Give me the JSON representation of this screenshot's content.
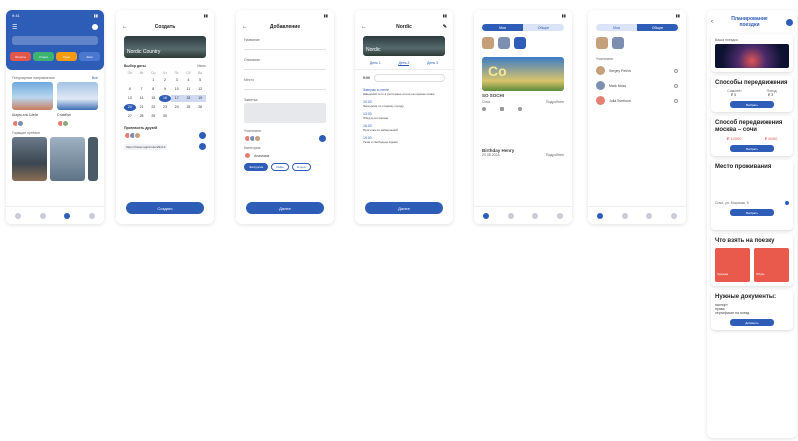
{
  "screen1": {
    "status_time": "9:41",
    "chips": [
      "Билеты",
      "Отели",
      "Туры",
      "Авто"
    ],
    "chip_colors": [
      "#e2574c",
      "#3cb371",
      "#f39c12",
      "#2e5db8"
    ],
    "section1_title": "Популярные направления",
    "section1_more": "Все",
    "item1_title": "Шарм-эль-Шейх",
    "item2_title": "Стамбул",
    "section2_title": "Горящие путёвки"
  },
  "screen2": {
    "title": "Создать",
    "hero_text": "Nordic Country",
    "dates_label": "Выбор даты",
    "month": "Июнь",
    "weekdays": [
      "Пн",
      "Вт",
      "Ср",
      "Чт",
      "Пт",
      "Сб",
      "Вс"
    ],
    "days": [
      "",
      "",
      "1",
      "2",
      "3",
      "4",
      "5",
      "6",
      "7",
      "8",
      "9",
      "10",
      "11",
      "12",
      "13",
      "14",
      "15",
      "16",
      "17",
      "18",
      "19",
      "20",
      "21",
      "22",
      "23",
      "24",
      "25",
      "26",
      "27",
      "28",
      "29",
      "30",
      "",
      "",
      ""
    ],
    "friends_label": "Пригласить друзей",
    "link_text": "https://travel.app/invite/29xK3",
    "button": "Создать"
  },
  "screen3": {
    "title": "Добавление",
    "field_labels": [
      "Название",
      "Описание",
      "Место",
      "Заметка"
    ],
    "members_label": "Участники",
    "places_label": "Категория",
    "place_name": "Anastasia",
    "pills": [
      "Экскурсия",
      "Кафе",
      "Отдых"
    ],
    "button": "Далее"
  },
  "screen4": {
    "title": "Nordic",
    "hero_text": "Nordic",
    "day_tabs": [
      "День 1",
      "День 2",
      "День 3"
    ],
    "time_label": "9:00",
    "rows": [
      {
        "head": "Завтрак в отеле",
        "body": "Шведский стол в ресторане отеля на первом этаже"
      },
      {
        "head": "10:00",
        "body": "Экскурсия по старому городу"
      },
      {
        "head": "13:00",
        "body": "Обед в ресторане"
      },
      {
        "head": "16:00",
        "body": "Прогулка по набережной"
      },
      {
        "head": "19:00",
        "body": "Ужин и свободное время"
      }
    ],
    "button": "Далее"
  },
  "screen5": {
    "seg": [
      "Мои",
      "Общие"
    ],
    "card_title": "SO SOCHI",
    "card_sub": "Сочи",
    "card_action": "Подробнее",
    "second_title": "Birthday Henry",
    "second_sub": "20.08.2024",
    "second_action": "Подробнее"
  },
  "screen6": {
    "seg": [
      "Мои",
      "Общие"
    ],
    "people": [
      "Sergey Petrov",
      "Mark Moss",
      "Julia Svetlova"
    ],
    "section_label": "Участники"
  },
  "tall": {
    "title": "Планирование поездки",
    "card1_label": "Ваша поездка",
    "card2_title": "Способы передвижения",
    "card2_opts": [
      "Самолёт",
      "Поезд"
    ],
    "card2_vals": [
      "₽ 5",
      "₽ 3"
    ],
    "card2_btn": "Выбрать",
    "card3_title": "Способ передвижения москва – сочи",
    "card3_vals": [
      "₽ 12000",
      "₽ 8000"
    ],
    "card3_btn": "Выбрать",
    "card4_title": "Место проживания",
    "card4_addr": "Сочи, ул. Морская, 5",
    "card4_btn": "Выбрать",
    "card5_title": "Что взять на поезку",
    "card5_items": [
      "Одежда",
      "Обувь"
    ],
    "card6_title": "Нужные документы:",
    "card6_lines": [
      "паспорт",
      "права",
      "сертификат на поезд"
    ],
    "card6_btn": "Добавить"
  }
}
